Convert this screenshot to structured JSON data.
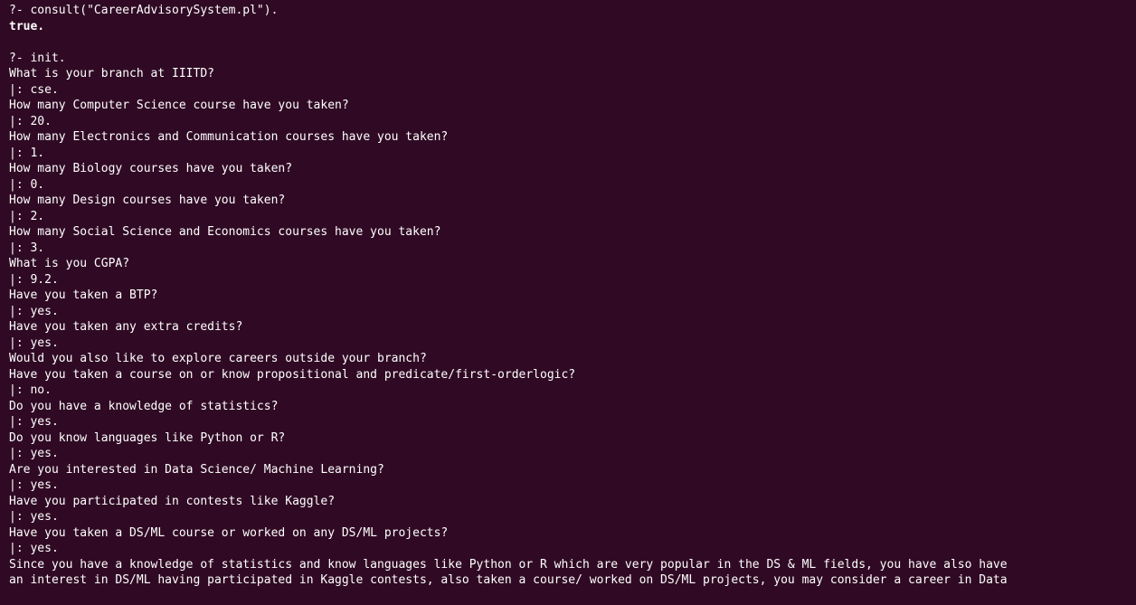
{
  "terminal": {
    "background_color": "#300a24",
    "text_color": "#ffffff",
    "lines": [
      {
        "text": "?- consult(\"CareerAdvisorySystem.pl\").",
        "bold": false
      },
      {
        "text": "true.",
        "bold": true
      },
      {
        "text": "",
        "bold": false
      },
      {
        "text": "?- init.",
        "bold": false
      },
      {
        "text": "What is your branch at IIITD?",
        "bold": false
      },
      {
        "text": "|: cse.",
        "bold": false
      },
      {
        "text": "How many Computer Science course have you taken?",
        "bold": false
      },
      {
        "text": "|: 20.",
        "bold": false
      },
      {
        "text": "How many Electronics and Communication courses have you taken?",
        "bold": false
      },
      {
        "text": "|: 1.",
        "bold": false
      },
      {
        "text": "How many Biology courses have you taken?",
        "bold": false
      },
      {
        "text": "|: 0.",
        "bold": false
      },
      {
        "text": "How many Design courses have you taken?",
        "bold": false
      },
      {
        "text": "|: 2.",
        "bold": false
      },
      {
        "text": "How many Social Science and Economics courses have you taken?",
        "bold": false
      },
      {
        "text": "|: 3.",
        "bold": false
      },
      {
        "text": "What is you CGPA?",
        "bold": false
      },
      {
        "text": "|: 9.2.",
        "bold": false
      },
      {
        "text": "Have you taken a BTP?",
        "bold": false
      },
      {
        "text": "|: yes.",
        "bold": false
      },
      {
        "text": "Have you taken any extra credits?",
        "bold": false
      },
      {
        "text": "|: yes.",
        "bold": false
      },
      {
        "text": "Would you also like to explore careers outside your branch?",
        "bold": false
      },
      {
        "text": "Have you taken a course on or know propositional and predicate/first-orderlogic?",
        "bold": false
      },
      {
        "text": "|: no.",
        "bold": false
      },
      {
        "text": "Do you have a knowledge of statistics?",
        "bold": false
      },
      {
        "text": "|: yes.",
        "bold": false
      },
      {
        "text": "Do you know languages like Python or R?",
        "bold": false
      },
      {
        "text": "|: yes.",
        "bold": false
      },
      {
        "text": "Are you interested in Data Science/ Machine Learning?",
        "bold": false
      },
      {
        "text": "|: yes.",
        "bold": false
      },
      {
        "text": "Have you participated in contests like Kaggle?",
        "bold": false
      },
      {
        "text": "|: yes.",
        "bold": false
      },
      {
        "text": "Have you taken a DS/ML course or worked on any DS/ML projects?",
        "bold": false
      },
      {
        "text": "|: yes.",
        "bold": false
      },
      {
        "text": "Since you have a knowledge of statistics and know languages like Python or R which are very popular in the DS & ML fields, you have also have",
        "bold": false
      },
      {
        "text": "an interest in DS/ML having participated in Kaggle contests, also taken a course/ worked on DS/ML projects, you may consider a career in Data",
        "bold": false
      }
    ]
  }
}
